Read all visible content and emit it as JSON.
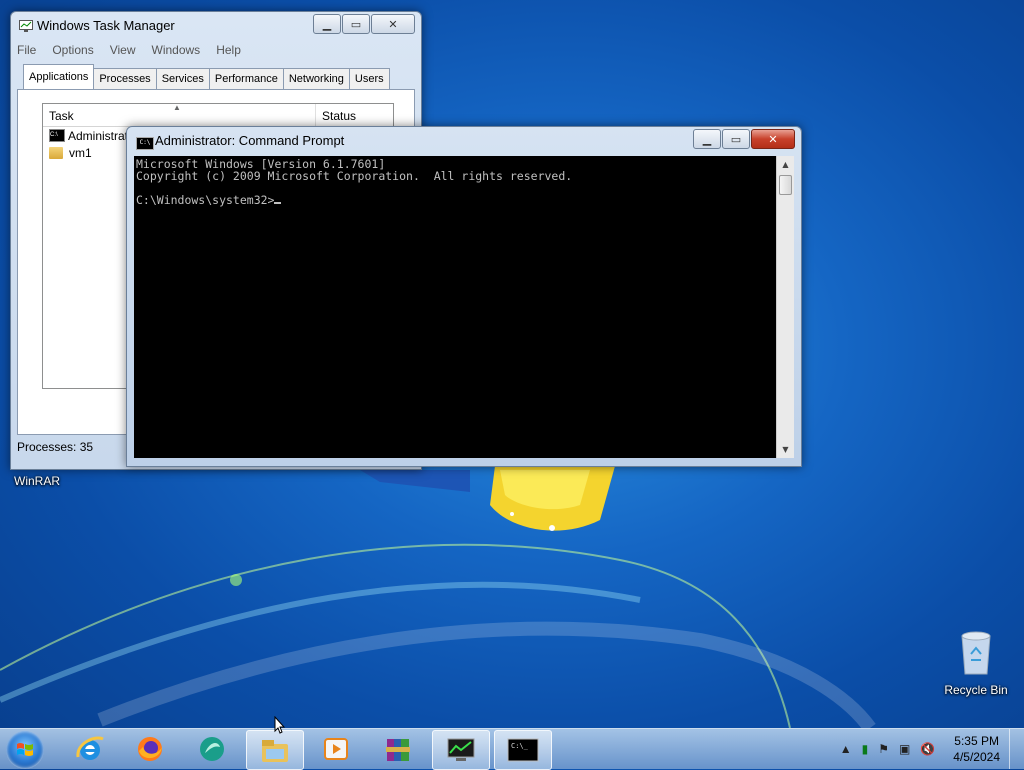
{
  "desktop": {
    "icons": [
      {
        "label": "WinRAR"
      },
      {
        "label": "Recycle Bin"
      }
    ]
  },
  "task_manager": {
    "title": "Windows Task Manager",
    "menu": [
      "File",
      "Options",
      "View",
      "Windows",
      "Help"
    ],
    "tabs": [
      "Applications",
      "Processes",
      "Services",
      "Performance",
      "Networking",
      "Users"
    ],
    "selected_tab": "Applications",
    "columns": {
      "task": "Task",
      "status": "Status"
    },
    "rows": [
      {
        "task": "Administrato",
        "icon": "cmd-icon"
      },
      {
        "task": "vm1",
        "icon": "folder-icon"
      }
    ],
    "status_bar": "Processes: 35"
  },
  "command_prompt": {
    "title": "Administrator:  Command Prompt",
    "lines": [
      "Microsoft Windows [Version 6.1.7601]",
      "Copyright (c) 2009 Microsoft Corporation.  All rights reserved.",
      "",
      "C:\\Windows\\system32>"
    ]
  },
  "taskbar": {
    "pinned": [
      {
        "name": "internet-explorer"
      },
      {
        "name": "firefox"
      },
      {
        "name": "kompozer"
      },
      {
        "name": "windows-explorer",
        "open": true
      },
      {
        "name": "media-player"
      },
      {
        "name": "winrar"
      },
      {
        "name": "task-manager",
        "open": true
      },
      {
        "name": "command-prompt",
        "open": true
      }
    ],
    "time": "5:35 PM",
    "date": "4/5/2024"
  },
  "colors": {
    "desktop_blue": "#1566c4",
    "console_bg": "#000000",
    "console_fg": "#c0c0c0",
    "close_red": "#c8412b"
  }
}
